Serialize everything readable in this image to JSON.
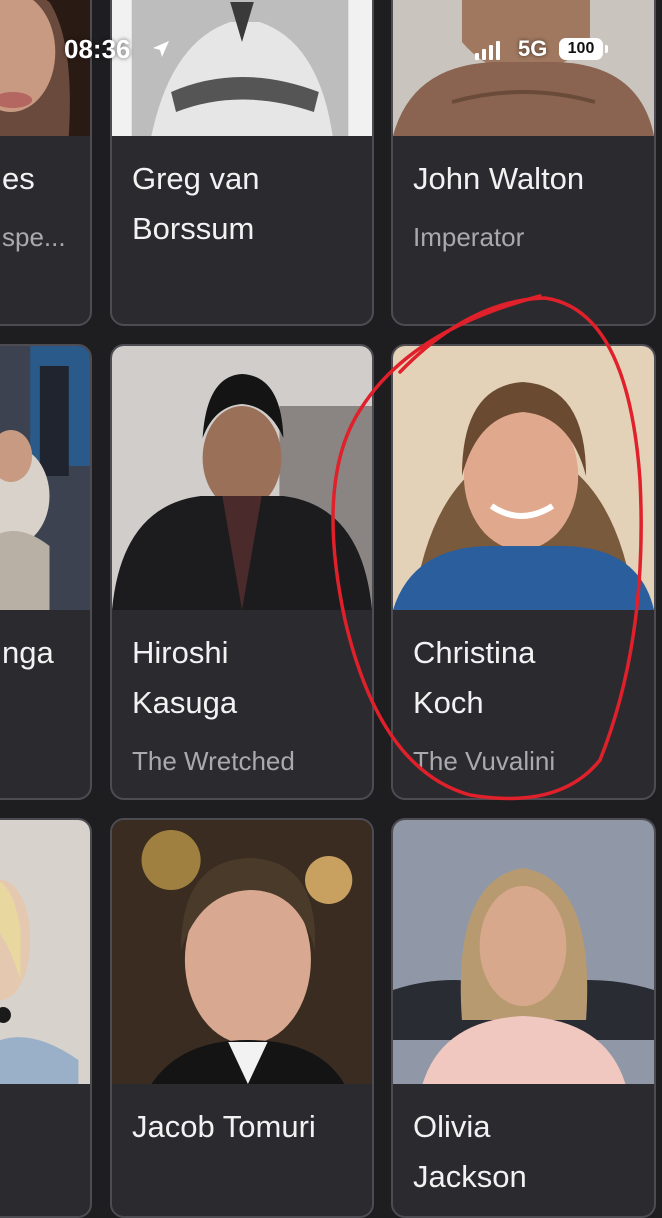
{
  "status_bar": {
    "time": "08:36",
    "network": "5G",
    "battery": "100"
  },
  "cards": [
    {
      "name_lines": [
        "es",
        ""
      ],
      "role": "spe..."
    },
    {
      "name_lines": [
        "Greg van",
        "Borssum"
      ],
      "role": ""
    },
    {
      "name_lines": [
        "John Walton",
        ""
      ],
      "role": "Imperator"
    },
    {
      "name_lines": [
        "nga",
        ""
      ],
      "role": ""
    },
    {
      "name_lines": [
        "Hiroshi",
        "Kasuga"
      ],
      "role": "The Wretched"
    },
    {
      "name_lines": [
        "Christina",
        "Koch"
      ],
      "role": "The Vuvalini"
    },
    {
      "name_lines": [
        "",
        ""
      ],
      "role": ""
    },
    {
      "name_lines": [
        "Jacob Tomuri",
        ""
      ],
      "role": ""
    },
    {
      "name_lines": [
        "Olivia",
        "Jackson"
      ],
      "role": ""
    }
  ],
  "colors": {
    "background": "#1e1e21",
    "card": "#2b2b2f",
    "card_border": "#4c4c52",
    "annotation": "#e0202a"
  }
}
